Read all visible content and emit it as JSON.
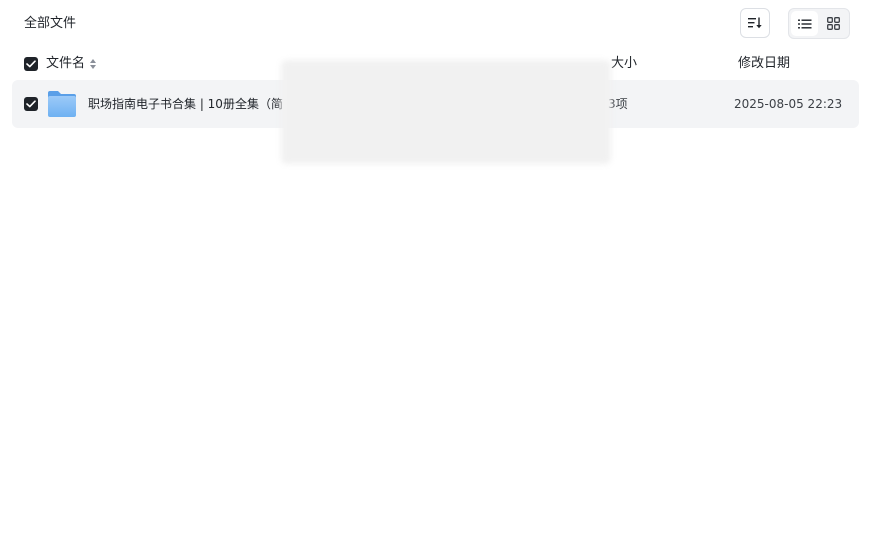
{
  "breadcrumb": {
    "current": "全部文件"
  },
  "toolbar": {
    "sort_icon": "sort-icon",
    "list_view_icon": "list-view-icon",
    "grid_view_icon": "grid-view-icon",
    "active_view": "list"
  },
  "table": {
    "header": {
      "select_all_checked": true,
      "columns": {
        "name": "文件名",
        "size": "大小",
        "modified": "修改日期"
      }
    },
    "rows": [
      {
        "checked": true,
        "icon": "folder-icon",
        "name": "职场指南电子书合集 | 10册全集（简",
        "size": "3项",
        "modified": "2025-08-05 22:23"
      }
    ]
  },
  "colors": {
    "checkbox": "#1f2329",
    "row_selected_bg": "#f3f4f6",
    "folder_blue": "#7ab8f5"
  }
}
